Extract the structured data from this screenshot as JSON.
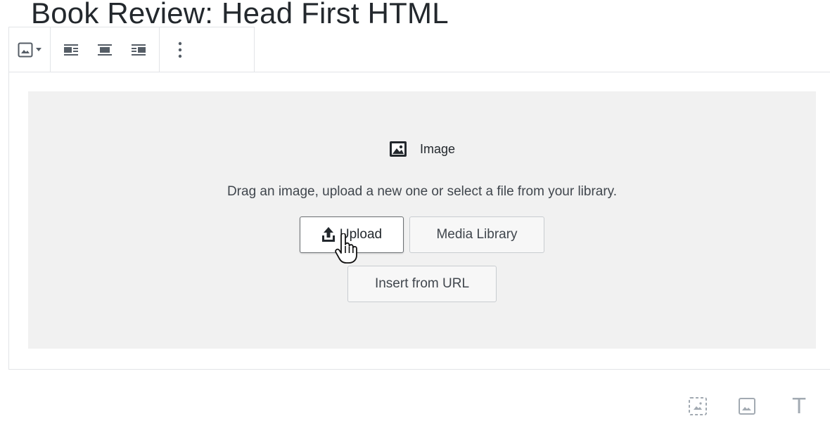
{
  "post": {
    "title": "Book Review: Head First HTML"
  },
  "block_toolbar": {
    "items": [
      {
        "name": "image-block-icon"
      },
      {
        "name": "chevron-down-icon"
      },
      {
        "name": "align-left-icon"
      },
      {
        "name": "align-center-icon"
      },
      {
        "name": "align-right-icon"
      },
      {
        "name": "more-options-icon"
      }
    ]
  },
  "image_block": {
    "label": "Image",
    "icon": "image-icon",
    "instructions": "Drag an image, upload a new one or select a file from your library.",
    "upload_label": "Upload",
    "upload_icon": "upload-icon",
    "media_library_label": "Media Library",
    "insert_url_label": "Insert from URL"
  },
  "inserter_shortcuts": {
    "items": [
      {
        "name": "gallery-icon"
      },
      {
        "name": "image-icon"
      },
      {
        "name": "text-icon",
        "glyph": "T"
      }
    ]
  },
  "colors": {
    "text": "#23282d",
    "muted": "#40464d",
    "placeholder_bg": "#f1f1f1",
    "border": "#e2e4e7",
    "icon_gray": "#a2aab2"
  }
}
